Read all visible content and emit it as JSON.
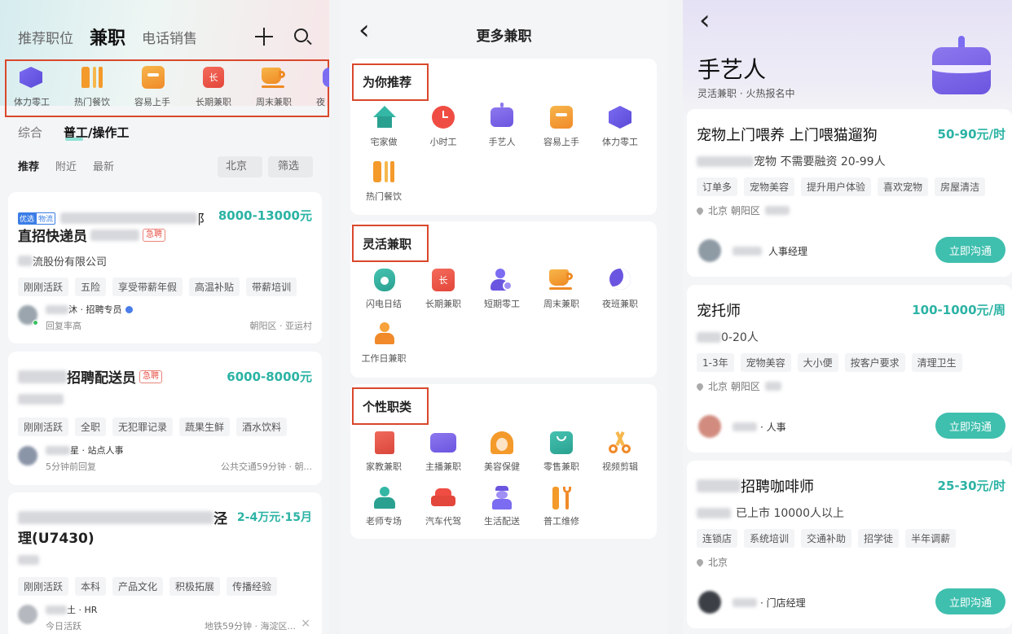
{
  "left": {
    "tabs": [
      "推荐职位",
      "兼职",
      "电话销售"
    ],
    "categories": [
      {
        "label": "体力零工",
        "icon": "cube-icon"
      },
      {
        "label": "热门餐饮",
        "icon": "fork-knife-icon"
      },
      {
        "label": "容易上手",
        "icon": "easy-hand-icon"
      },
      {
        "label": "长期兼职",
        "icon": "calendar-icon"
      },
      {
        "label": "周末兼职",
        "icon": "coffee-icon"
      },
      {
        "label": "夜",
        "icon": "moon-icon"
      }
    ],
    "subtabs": [
      "综合",
      "普工/操作工"
    ],
    "filters": [
      "推荐",
      "附近",
      "最新"
    ],
    "city": "北京",
    "screen": "筛选",
    "jobs": [
      {
        "badge1": "优选",
        "badge2": "物流",
        "title_tail": "阝",
        "title2": "直招快递员",
        "urgent": "急聘",
        "salary": "8000-13000元",
        "company": "流股份有限公司",
        "tags": [
          "刚刚活跃",
          "五险",
          "享受带薪年假",
          "高温补贴",
          "带薪培训"
        ],
        "recruiter": "沐 · 招聘专员",
        "reply": "回复率高",
        "loc": "朝阳区 · 亚运村"
      },
      {
        "title": "招聘配送员",
        "urgent": "急聘",
        "salary": "6000-8000元",
        "company": "",
        "tags": [
          "刚刚活跃",
          "全职",
          "无犯罪记录",
          "蔬果生鲜",
          "酒水饮料"
        ],
        "recruiter": "星 · 站点人事",
        "reply": "5分钟前回复",
        "loc": "公共交通59分钟 · 朝..."
      },
      {
        "title_tail": "泾",
        "title2": "理(U7430)",
        "salary": "2-4万元·15月",
        "company": "",
        "tags": [
          "刚刚活跃",
          "本科",
          "产品文化",
          "积极拓展",
          "传播经验"
        ],
        "recruiter": "土 · HR",
        "reply": "今日活跃",
        "loc": "地铁59分钟 · 海淀区...",
        "close": "×"
      }
    ]
  },
  "middle": {
    "back": "‹",
    "title": "更多兼职",
    "sections": [
      {
        "title": "为你推荐",
        "items": [
          {
            "label": "宅家做",
            "icon": "home-icon"
          },
          {
            "label": "小时工",
            "icon": "clock-icon"
          },
          {
            "label": "手艺人",
            "icon": "cake-icon"
          },
          {
            "label": "容易上手",
            "icon": "easy-hand-icon"
          },
          {
            "label": "体力零工",
            "icon": "cube-icon"
          },
          {
            "label": "热门餐饮",
            "icon": "fork-knife-icon"
          }
        ]
      },
      {
        "title": "灵活兼职",
        "items": [
          {
            "label": "闪电日结",
            "icon": "money-bag-icon"
          },
          {
            "label": "长期兼职",
            "icon": "calendar-icon"
          },
          {
            "label": "短期零工",
            "icon": "person-clock-icon"
          },
          {
            "label": "周末兼职",
            "icon": "coffee-icon"
          },
          {
            "label": "夜班兼职",
            "icon": "moon-icon"
          },
          {
            "label": "工作日兼职",
            "icon": "worker-icon"
          }
        ]
      },
      {
        "title": "个性职类",
        "items": [
          {
            "label": "家教兼职",
            "icon": "book-icon"
          },
          {
            "label": "主播兼职",
            "icon": "video-icon"
          },
          {
            "label": "美容保健",
            "icon": "hair-icon"
          },
          {
            "label": "零售兼职",
            "icon": "shopping-bag-icon"
          },
          {
            "label": "视频剪辑",
            "icon": "scissors-icon"
          },
          {
            "label": "老师专场",
            "icon": "teacher-icon"
          },
          {
            "label": "汽车代驾",
            "icon": "car-icon"
          },
          {
            "label": "生活配送",
            "icon": "courier-icon"
          },
          {
            "label": "普工维修",
            "icon": "wrench-icon"
          }
        ]
      }
    ]
  },
  "right": {
    "back": "‹",
    "title": "手艺人",
    "subtitle": "灵活兼职 · 火热报名中",
    "jobs": [
      {
        "title": "宠物上门喂养 上门喂猫遛狗",
        "salary": "50-90元/时",
        "info": "宠物  不需要融资  20-99人",
        "tags": [
          "订单多",
          "宠物美容",
          "提升用户体验",
          "喜欢宠物",
          "房屋清洁"
        ],
        "loc": "北京  朝阳区",
        "recruiter": "人事经理",
        "btn": "立即沟通"
      },
      {
        "title": "宠托师",
        "salary": "100-1000元/周",
        "info": "0-20人",
        "tags": [
          "1-3年",
          "宠物美容",
          "大小便",
          "按客户要求",
          "清理卫生"
        ],
        "loc": "北京  朝阳区",
        "recruiter": "· 人事",
        "btn": "立即沟通"
      },
      {
        "title": "招聘咖啡师",
        "salary": "25-30元/时",
        "info": "已上市  10000人以上",
        "tags": [
          "连锁店",
          "系统培训",
          "交通补助",
          "招学徒",
          "半年调薪"
        ],
        "loc": "北京",
        "recruiter": "· 门店经理",
        "btn": "立即沟通"
      }
    ]
  }
}
